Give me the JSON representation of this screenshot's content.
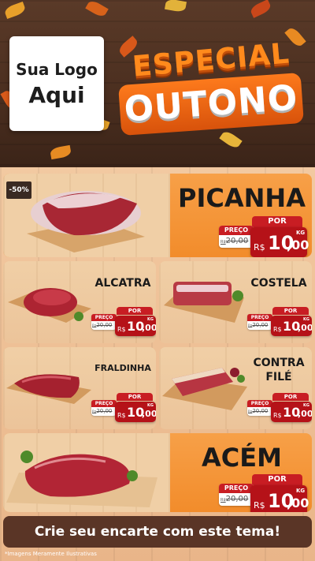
{
  "header": {
    "logo_line1": "Sua Logo",
    "logo_line2": "Aqui",
    "title_line1": "ESPECIAL",
    "title_line2": "OUTONO"
  },
  "colors": {
    "accent_orange": "#f28c2b",
    "price_red": "#b51218",
    "wood_dark": "#4a2e1f",
    "cta_brown": "#5a3526"
  },
  "discount_badge": "-50%",
  "products": [
    {
      "name": "PICANHA",
      "por": "POR",
      "preco": "PREÇO",
      "old_prefix": "R$",
      "old": "20,00",
      "currency": "R$",
      "int": "10",
      "cents": ",00",
      "unit": "KG"
    },
    {
      "name": "ALCATRA",
      "por": "POR",
      "preco": "PREÇO",
      "old_prefix": "R$",
      "old": "20,00",
      "currency": "R$",
      "int": "10",
      "cents": ",00",
      "unit": "KG"
    },
    {
      "name": "COSTELA",
      "por": "POR",
      "preco": "PREÇO",
      "old_prefix": "R$",
      "old": "20,00",
      "currency": "R$",
      "int": "10",
      "cents": ",00",
      "unit": "KG"
    },
    {
      "name": "FRALDINHA",
      "por": "POR",
      "preco": "PREÇO",
      "old_prefix": "R$",
      "old": "20,00",
      "currency": "R$",
      "int": "10",
      "cents": ",00",
      "unit": "KG"
    },
    {
      "name_line1": "CONTRA",
      "name_line2": "FILÉ",
      "por": "POR",
      "preco": "PREÇO",
      "old_prefix": "R$",
      "old": "20,00",
      "currency": "R$",
      "int": "10",
      "cents": ",00",
      "unit": "KG"
    },
    {
      "name": "ACÉM",
      "por": "POR",
      "preco": "PREÇO",
      "old_prefix": "R$",
      "old": "20,00",
      "currency": "R$",
      "int": "10",
      "cents": ",00",
      "unit": "KG"
    }
  ],
  "cta": "Crie seu encarte com este tema!",
  "footnote": "*Imagens Meramente Ilustrativas"
}
